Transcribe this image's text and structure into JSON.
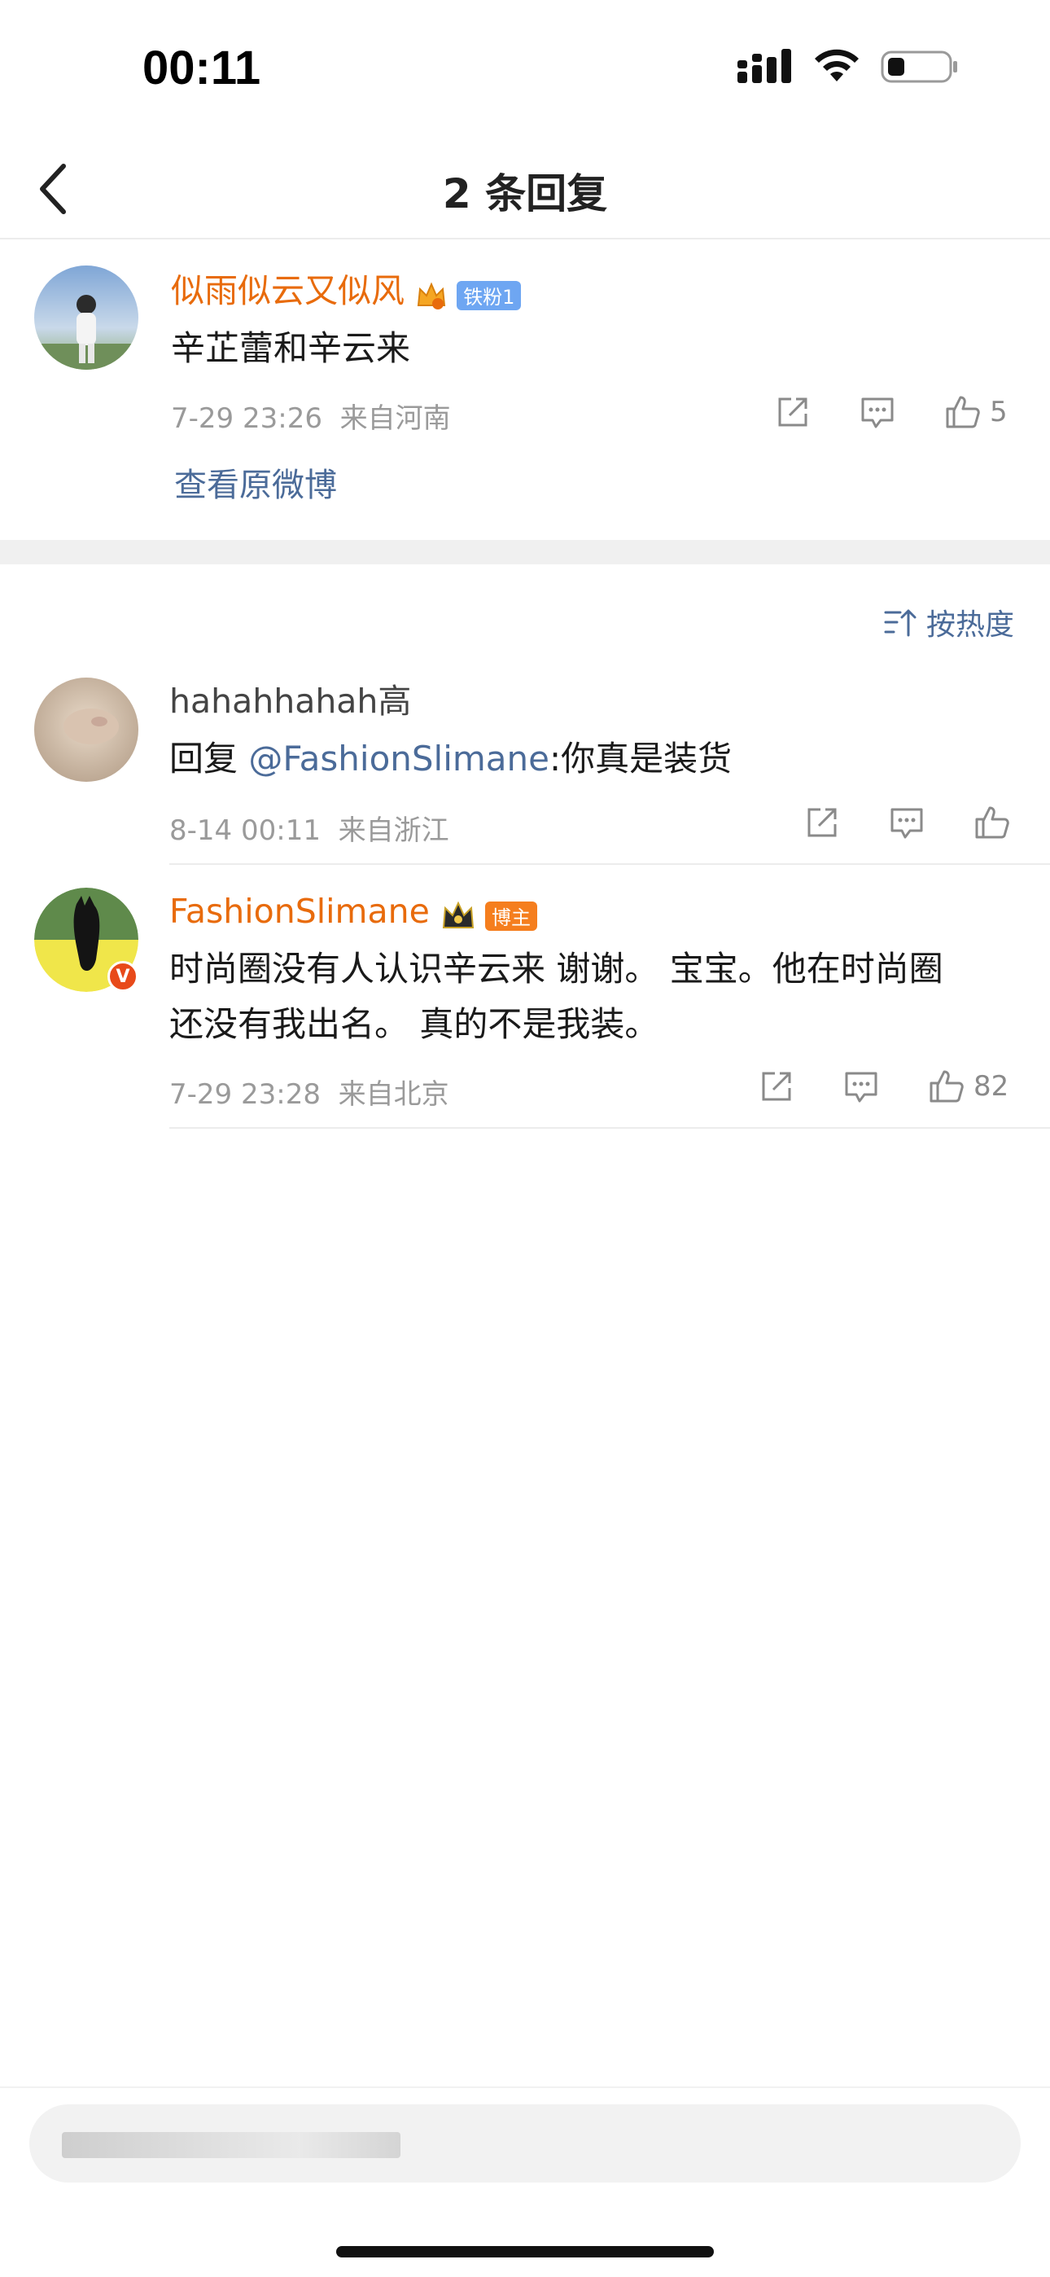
{
  "status_bar": {
    "time": "00:11"
  },
  "nav": {
    "title": "2 条回复"
  },
  "root_comment": {
    "username": "似雨似云又似风",
    "fan_badge": "铁粉1",
    "text": "辛芷蕾和辛云来",
    "meta": "7-29 23:26  来自河南",
    "likes": "5",
    "view_original": "查看原微博"
  },
  "sort": {
    "label": "按热度"
  },
  "replies": [
    {
      "username": "hahahhahah高",
      "reply_prefix": "回复 ",
      "mention": "@FashionSlimane",
      "text": ":你真是装货",
      "meta": "8-14 00:11  来自浙江",
      "likes": ""
    },
    {
      "username": "FashionSlimane",
      "owner_badge": "博主",
      "verified_mark": "V",
      "text_line1": "时尚圈没有人认识辛云来 谢谢。 宝宝。他在时尚圈",
      "text_line2": "还没有我出名。 真的不是我装。",
      "meta": "7-29 23:28  来自北京",
      "likes": "82"
    }
  ],
  "colors": {
    "accent_orange": "#e86b0c",
    "mention_blue": "#4b6b99"
  }
}
